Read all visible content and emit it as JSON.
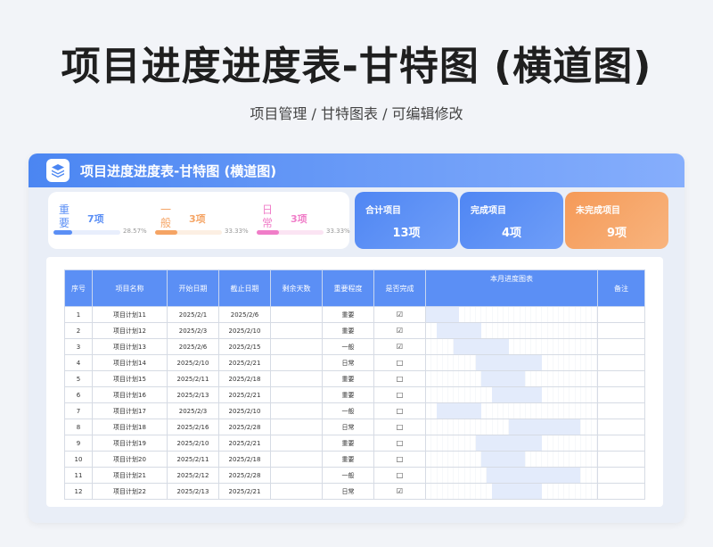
{
  "page": {
    "title": "项目进度进度表-甘特图 (横道图)",
    "subtitle": "项目管理 / 甘特图表 /  可编辑修改"
  },
  "card": {
    "title": "项目进度进度表-甘特图 (横道图)"
  },
  "importance": [
    {
      "label": "重要",
      "count": "7项",
      "percent": "28.57%",
      "fill": 0.2857,
      "color": "#5b8ff5",
      "track": "#e8eefc"
    },
    {
      "label": "一般",
      "count": "3项",
      "percent": "33.33%",
      "fill": 0.3333,
      "color": "#f5a464",
      "track": "#fcefe3"
    },
    {
      "label": "日常",
      "count": "3项",
      "percent": "33.33%",
      "fill": 0.3333,
      "color": "#f07dc8",
      "track": "#fbe4f3"
    }
  ],
  "summary": [
    {
      "label": "合计项目",
      "value": "13项",
      "color_from": "#4f86f3",
      "color_to": "#6f9ef8"
    },
    {
      "label": "完成项目",
      "value": "4项",
      "color_from": "#4f86f3",
      "color_to": "#6f9ef8"
    },
    {
      "label": "未完成项目",
      "value": "9项",
      "color_from": "#f59a58",
      "color_to": "#f8b47e"
    }
  ],
  "table": {
    "headers": [
      "序号",
      "项目名称",
      "开始日期",
      "截止日期",
      "剩余天数",
      "重要程度",
      "是否完成",
      "本月进度图表",
      "备注"
    ],
    "rows": [
      {
        "no": "1",
        "name": "项目计划11",
        "start": "2025/2/1",
        "end": "2025/2/6",
        "remaining": "",
        "level": "重要",
        "done": "☑",
        "remark": "",
        "gantt_start": 1,
        "gantt_end": 6
      },
      {
        "no": "2",
        "name": "项目计划12",
        "start": "2025/2/3",
        "end": "2025/2/10",
        "remaining": "",
        "level": "重要",
        "done": "☑",
        "remark": "",
        "gantt_start": 3,
        "gantt_end": 10
      },
      {
        "no": "3",
        "name": "项目计划13",
        "start": "2025/2/6",
        "end": "2025/2/15",
        "remaining": "",
        "level": "一般",
        "done": "☑",
        "remark": "",
        "gantt_start": 6,
        "gantt_end": 15
      },
      {
        "no": "4",
        "name": "项目计划14",
        "start": "2025/2/10",
        "end": "2025/2/21",
        "remaining": "",
        "level": "日常",
        "done": "□",
        "remark": "",
        "gantt_start": 10,
        "gantt_end": 21
      },
      {
        "no": "5",
        "name": "项目计划15",
        "start": "2025/2/11",
        "end": "2025/2/18",
        "remaining": "",
        "level": "重要",
        "done": "□",
        "remark": "",
        "gantt_start": 11,
        "gantt_end": 18
      },
      {
        "no": "6",
        "name": "项目计划16",
        "start": "2025/2/13",
        "end": "2025/2/21",
        "remaining": "",
        "level": "重要",
        "done": "□",
        "remark": "",
        "gantt_start": 13,
        "gantt_end": 21
      },
      {
        "no": "7",
        "name": "项目计划17",
        "start": "2025/2/3",
        "end": "2025/2/10",
        "remaining": "",
        "level": "一般",
        "done": "□",
        "remark": "",
        "gantt_start": 3,
        "gantt_end": 10
      },
      {
        "no": "8",
        "name": "项目计划18",
        "start": "2025/2/16",
        "end": "2025/2/28",
        "remaining": "",
        "level": "日常",
        "done": "□",
        "remark": "",
        "gantt_start": 16,
        "gantt_end": 28
      },
      {
        "no": "9",
        "name": "项目计划19",
        "start": "2025/2/10",
        "end": "2025/2/21",
        "remaining": "",
        "level": "重要",
        "done": "□",
        "remark": "",
        "gantt_start": 10,
        "gantt_end": 21
      },
      {
        "no": "10",
        "name": "项目计划20",
        "start": "2025/2/11",
        "end": "2025/2/18",
        "remaining": "",
        "level": "重要",
        "done": "□",
        "remark": "",
        "gantt_start": 11,
        "gantt_end": 18
      },
      {
        "no": "11",
        "name": "项目计划21",
        "start": "2025/2/12",
        "end": "2025/2/28",
        "remaining": "",
        "level": "一般",
        "done": "□",
        "remark": "",
        "gantt_start": 12,
        "gantt_end": 28
      },
      {
        "no": "12",
        "name": "项目计划22",
        "start": "2025/2/13",
        "end": "2025/2/21",
        "remaining": "",
        "level": "日常",
        "done": "☑",
        "remark": "",
        "gantt_start": 13,
        "gantt_end": 21
      }
    ],
    "gantt_days": 31
  }
}
